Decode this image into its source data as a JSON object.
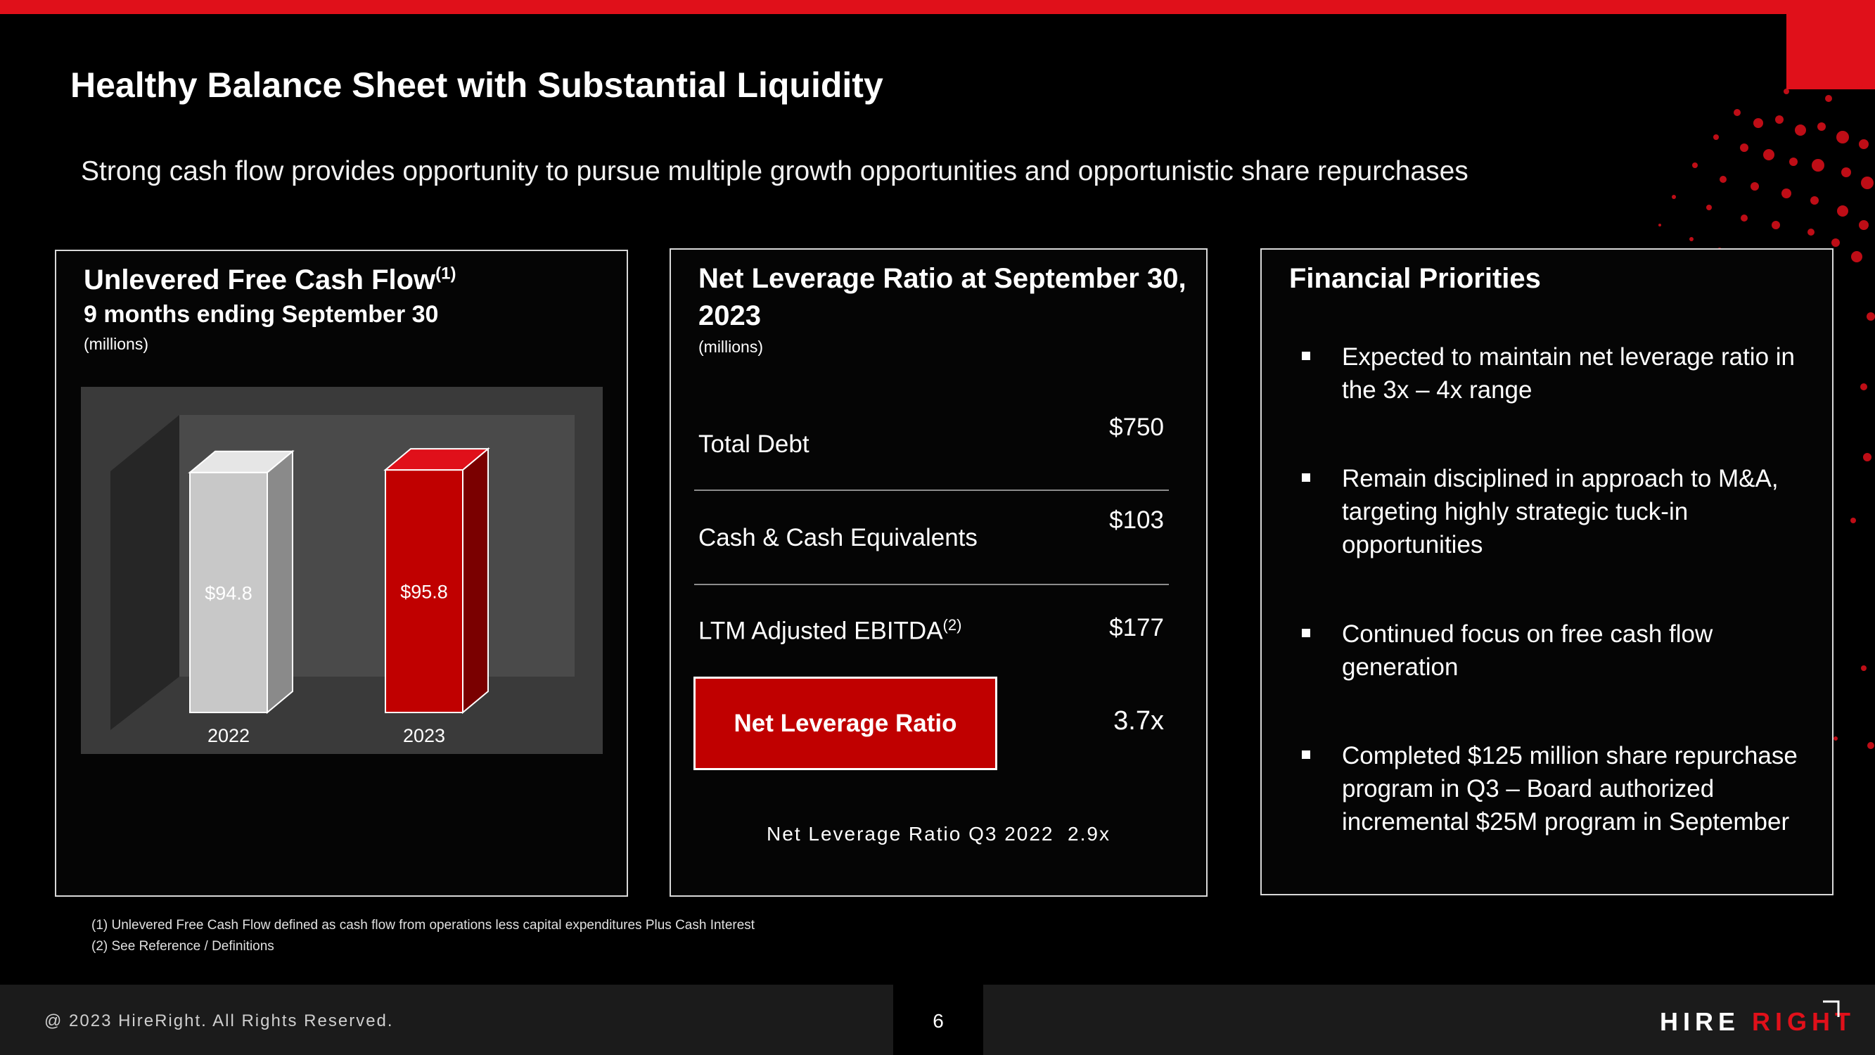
{
  "title": "Healthy Balance Sheet with Substantial Liquidity",
  "subtitle": "Strong cash flow provides opportunity to pursue multiple growth opportunities and opportunistic share repurchases",
  "colors": {
    "accent": "#e0101a",
    "bar_2022": "#c8c8c8",
    "bar_2023": "#c00000",
    "background": "#000000"
  },
  "fcf_panel": {
    "heading": "Unlevered Free Cash Flow",
    "heading_sup": "(1)",
    "period": "9 months ending September 30",
    "units": "(millions)"
  },
  "chart_data": {
    "type": "bar",
    "categories": [
      "2022",
      "2023"
    ],
    "values": [
      94.8,
      95.8
    ],
    "data_labels": [
      "$94.8",
      "$95.8"
    ],
    "title": "Unlevered Free Cash Flow",
    "ylim": [
      0,
      100
    ],
    "legend": "none",
    "grid": false
  },
  "leverage_panel": {
    "heading_line1": "Net Leverage Ratio at September 30,",
    "heading_line2": "2023",
    "units": "(millions)",
    "rows": [
      {
        "label": "Total Debt",
        "sup": "",
        "value": "$750"
      },
      {
        "label": "Cash & Cash Equivalents",
        "sup": "",
        "value": "$103"
      },
      {
        "label": "LTM Adjusted EBITDA",
        "sup": "(2)",
        "value": "$177"
      }
    ],
    "ratio_label": "Net Leverage Ratio",
    "ratio_value": "3.7x",
    "prior_note": "Net Leverage Ratio Q3 2022  2.9x"
  },
  "priorities_panel": {
    "heading": "Financial Priorities",
    "bullets": [
      "Expected to maintain net leverage ratio in the 3x – 4x range",
      "Remain disciplined in approach to M&A, targeting highly strategic tuck-in opportunities",
      "Continued focus on free cash flow generation",
      "Completed $125 million share repurchase program in Q3 – Board authorized incremental $25M program in September"
    ]
  },
  "footnotes": [
    "(1)   Unlevered Free Cash Flow defined as cash flow from operations less capital expenditures Plus Cash Interest",
    "(2)   See Reference / Definitions"
  ],
  "footer": {
    "copyright": "@ 2023  HireRight. All Rights Reserved.",
    "page_number": "6",
    "logo_part1": "HIRE ",
    "logo_part2": "RIGHT"
  }
}
